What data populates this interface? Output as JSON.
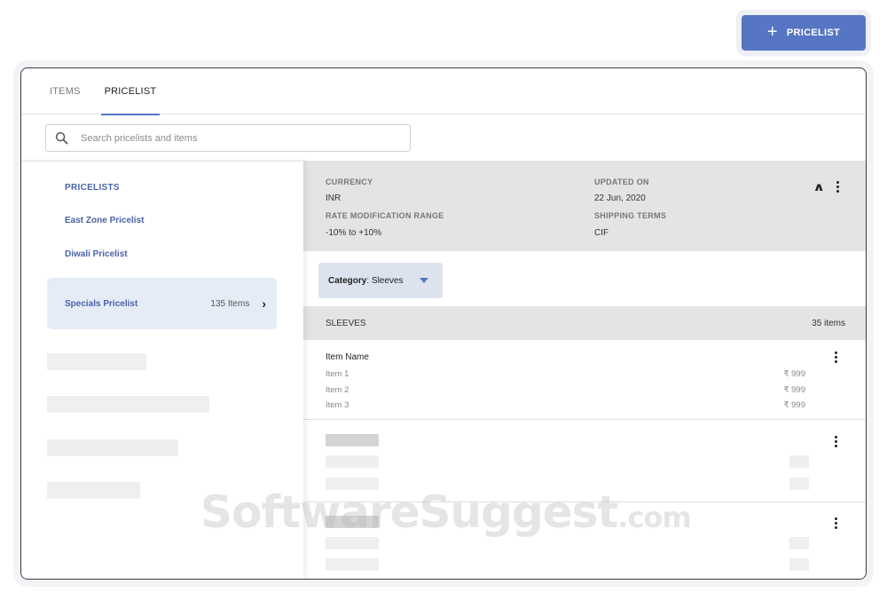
{
  "header": {
    "add_button_label": "PRICELIST",
    "add_icon": "plus-icon"
  },
  "tabs": [
    {
      "label": "ITEMS",
      "active": false
    },
    {
      "label": "PRICELIST",
      "active": true
    }
  ],
  "search": {
    "placeholder": "Search pricelists and items",
    "value": ""
  },
  "sidebar": {
    "heading": "PRICELISTS",
    "items": [
      {
        "label": "East Zone Pricelist"
      },
      {
        "label": "Diwali Pricelist"
      }
    ],
    "selected": {
      "label": "Specials Pricelist",
      "count": "135 Items"
    }
  },
  "details": {
    "currency_label": "CURRENCY",
    "currency_value": "INR",
    "updated_label": "UPDATED ON",
    "updated_value": "22 Jun, 2020",
    "range_label": "RATE MODIFICATION RANGE",
    "range_value": "-10% to +10%",
    "terms_label": "SHIPPING TERMS",
    "terms_value": "CIF"
  },
  "category_filter": {
    "label": "Category",
    "value": ": Sleeves"
  },
  "section": {
    "title": "SLEEVES",
    "count": "35 items"
  },
  "item_list": {
    "header": "Item Name",
    "rows": [
      {
        "name": "Item 1",
        "price": "₹ 999"
      },
      {
        "name": "Item 2",
        "price": "₹ 999"
      },
      {
        "name": "Item 3",
        "price": "₹ 999"
      }
    ]
  },
  "watermark": {
    "text": "SoftwareSuggest",
    "suffix": ".com"
  },
  "colors": {
    "accent": "#5676c4",
    "link": "#4a63a8",
    "panel": "#e4e4e4",
    "selected_bg": "#e6ecf6"
  }
}
